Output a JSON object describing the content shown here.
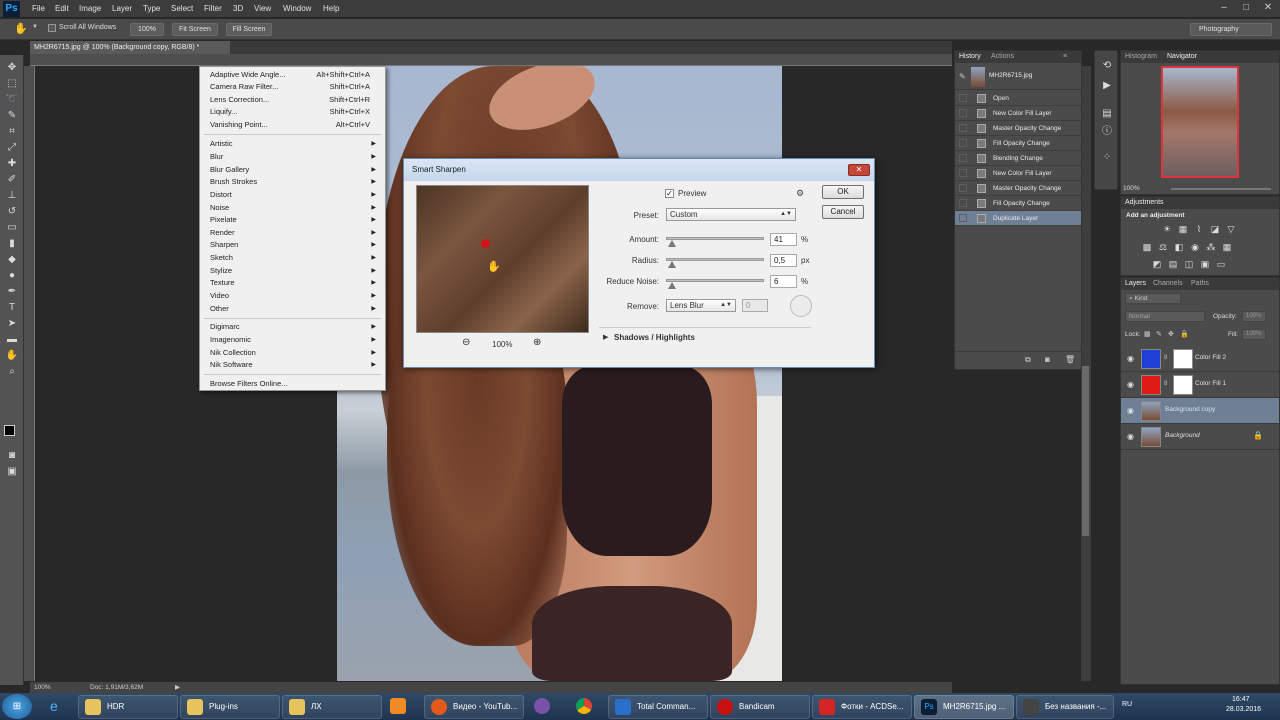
{
  "app": {
    "logo": "Ps",
    "menu": [
      "File",
      "Edit",
      "Image",
      "Layer",
      "Type",
      "Select",
      "Filter",
      "3D",
      "View",
      "Window",
      "Help"
    ],
    "workspace": "Photography"
  },
  "options": {
    "scroll_all": "Scroll All Windows",
    "btn_100": "100%",
    "fit_screen": "Fit Screen",
    "fill_screen": "Fill Screen"
  },
  "doc": {
    "tab": "MH2R6715.jpg @ 100% (Background copy, RGB/8) *",
    "zoom": "100%",
    "doc_size": "Doc: 1,91M/3,62M"
  },
  "filter_menu": {
    "top": [
      {
        "label": "Adaptive Wide Angle...",
        "sc": "Alt+Shift+Ctrl+A"
      },
      {
        "label": "Camera Raw Filter...",
        "sc": "Shift+Ctrl+A"
      },
      {
        "label": "Lens Correction...",
        "sc": "Shift+Ctrl+R"
      },
      {
        "label": "Liquify...",
        "sc": "Shift+Ctrl+X"
      },
      {
        "label": "Vanishing Point...",
        "sc": "Alt+Ctrl+V"
      }
    ],
    "groups": [
      "Artistic",
      "Blur",
      "Blur Gallery",
      "Brush Strokes",
      "Distort",
      "Noise",
      "Pixelate",
      "Render",
      "Sharpen",
      "Sketch",
      "Stylize",
      "Texture",
      "Video",
      "Other"
    ],
    "plugins": [
      "Digimarc",
      "Imagenomic",
      "Nik Collection",
      "Nik Software"
    ],
    "browse": "Browse Filters Online..."
  },
  "dialog": {
    "title": "Smart Sharpen",
    "preview_label": "Preview",
    "preview_checked": true,
    "ok": "OK",
    "cancel": "Cancel",
    "preset_label": "Preset:",
    "preset_value": "Custom",
    "amount_label": "Amount:",
    "amount_value": "41",
    "amount_unit": "%",
    "radius_label": "Radius:",
    "radius_value": "0,5",
    "radius_unit": "px",
    "noise_label": "Reduce Noise:",
    "noise_value": "6",
    "noise_unit": "%",
    "remove_label": "Remove:",
    "remove_value": "Lens Blur",
    "remove_angle": "0",
    "zoom": "100%",
    "shadows": "Shadows / Highlights",
    "amount_level": 0.02,
    "radius_level": 0.02,
    "noise_level": 0.02
  },
  "history": {
    "tabs": [
      "History",
      "Actions"
    ],
    "snapshot": "MH2R6715.jpg",
    "items": [
      "Open",
      "New Color Fill Layer",
      "Master Opacity Change",
      "Fill Opacity Change",
      "Blending Change",
      "New Color Fill Layer",
      "Master Opacity Change",
      "Fill Opacity Change",
      "Duplicate Layer"
    ]
  },
  "navigator": {
    "tabs": [
      "Histogram",
      "Navigator"
    ],
    "zoom": "100%"
  },
  "adjustments": {
    "tab": "Adjustments",
    "title": "Add an adjustment"
  },
  "layers": {
    "tabs": [
      "Layers",
      "Channels",
      "Paths"
    ],
    "kind": "Kind",
    "mode": "Normal",
    "opacity_label": "Opacity:",
    "opacity": "100%",
    "lock_label": "Lock:",
    "fill_label": "Fill:",
    "fill": "100%",
    "items": [
      {
        "name": "Color Fill 2",
        "color": "#1f3fd6"
      },
      {
        "name": "Color Fill 1",
        "color": "#e01a14"
      },
      {
        "name": "Background copy",
        "color": ""
      },
      {
        "name": "Background",
        "color": ""
      }
    ]
  },
  "taskbar": {
    "items": [
      "HDR",
      "Plug-ins",
      "ЛХ",
      "Видео - YouTub...",
      "Total Comman...",
      "Bandicam",
      "Фотки - ACDSe...",
      "MH2R6715.jpg ...",
      "Без названия -..."
    ],
    "lang": "RU",
    "time": "16:47",
    "date": "28.03.2016"
  }
}
